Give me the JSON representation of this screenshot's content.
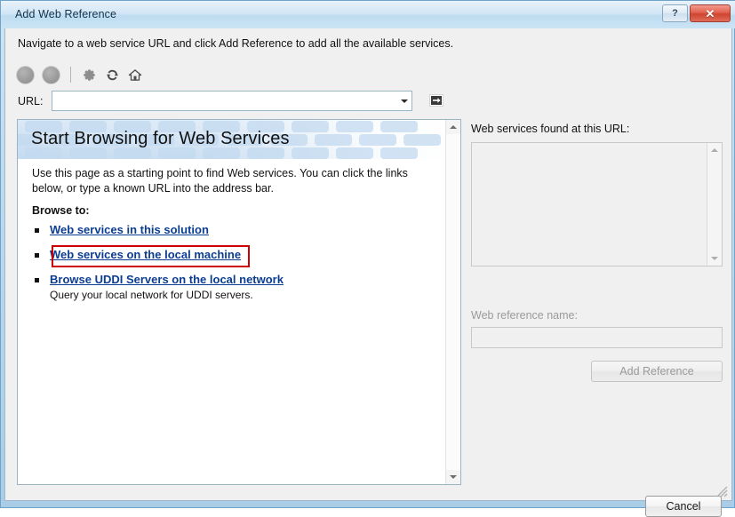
{
  "window": {
    "title": "Add Web Reference",
    "help_button": "?",
    "close_button": "✕"
  },
  "instruction": "Navigate to a web service URL and click Add Reference to add all the available services.",
  "toolbar": {
    "back_label": "Back",
    "forward_label": "Forward",
    "stop_label": "Stop",
    "refresh_label": "Refresh",
    "home_label": "Home"
  },
  "url_bar": {
    "label": "URL:",
    "value": "",
    "placeholder": "",
    "go_label": "Go"
  },
  "browser_page": {
    "title": "Start Browsing for Web Services",
    "body": "Use this page as a starting point to find Web services. You can click the links below, or type a known URL into the address bar.",
    "browse_to_heading": "Browse to:",
    "links": [
      {
        "label": "Web services in this solution",
        "sub": "",
        "highlighted": true
      },
      {
        "label": "Web services on the local machine",
        "sub": "",
        "highlighted": false
      },
      {
        "label": "Browse UDDI Servers on the local network",
        "sub": "Query your local network for UDDI servers.",
        "highlighted": false
      }
    ]
  },
  "results": {
    "found_label": "Web services found at this URL:",
    "items": [],
    "ref_name_label": "Web reference name:",
    "ref_name_value": "",
    "ref_name_placeholder": "",
    "add_reference_label": "Add Reference"
  },
  "footer": {
    "cancel_label": "Cancel"
  },
  "colors": {
    "link": "#0b3d91",
    "highlight_box": "#cc0000",
    "close_button": "#cf4430",
    "title_bar": "#cbe4f5",
    "page_header": "#cfe1f3"
  }
}
